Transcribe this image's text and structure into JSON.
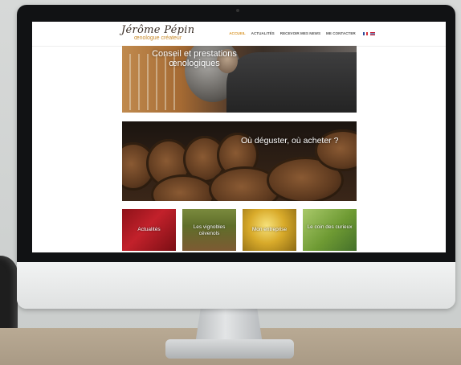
{
  "site": {
    "logo_name": "Jérôme Pépin",
    "logo_sub": "œnologue créateur"
  },
  "nav": {
    "items": [
      "ACCUEIL",
      "ACTUALITÉS",
      "RECEVOIR MES NEWS",
      "ME CONTACTER"
    ],
    "active_index": 0,
    "languages": [
      "FR",
      "EN"
    ]
  },
  "hero1": {
    "title": "Conseil et prestations œnologiques"
  },
  "hero2": {
    "title": "Où déguster, où acheter ?"
  },
  "tiles": [
    {
      "label": "Actualités"
    },
    {
      "label": "Les vignobles cévenols"
    },
    {
      "label": "Mon entreprise"
    },
    {
      "label": "Le coin des curieux"
    }
  ],
  "colors": {
    "accent": "#d9962b",
    "bezel": "#111214",
    "tile_red": "#c2212b",
    "tile_green": "#6e9a33"
  }
}
